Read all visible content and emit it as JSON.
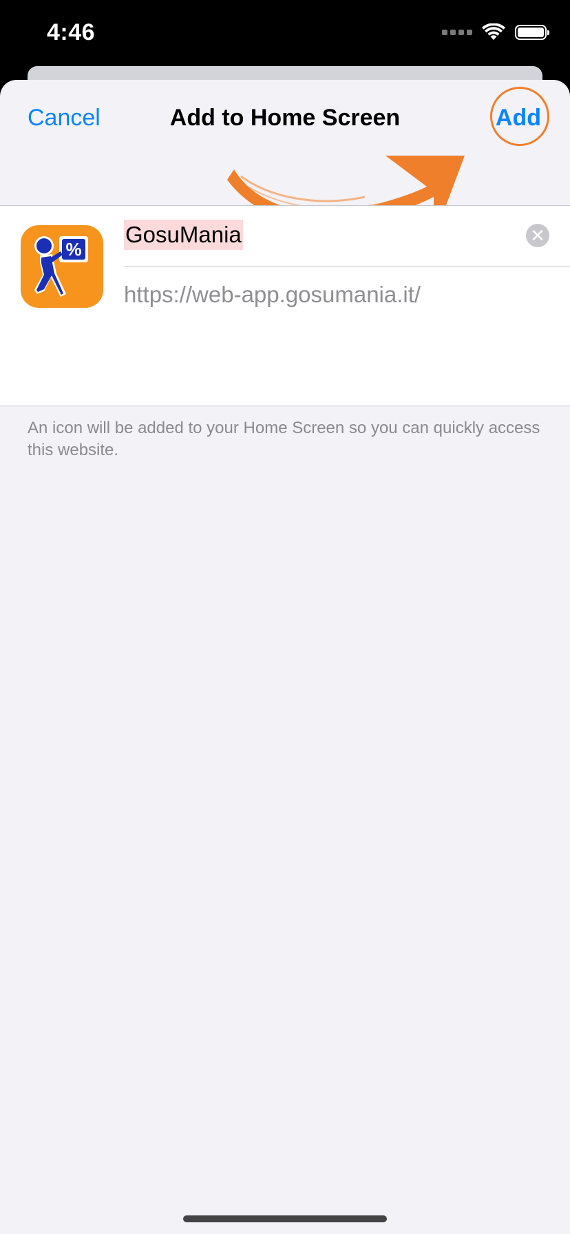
{
  "status_bar": {
    "time": "4:46"
  },
  "nav": {
    "cancel_label": "Cancel",
    "title": "Add to Home Screen",
    "add_label": "Add"
  },
  "form": {
    "name_value": "GosuMania",
    "url_value": "https://web-app.gosumania.it/",
    "clear_icon": "✕"
  },
  "footer": {
    "description": "An icon will be added to your Home Screen so you can quickly access this website."
  },
  "colors": {
    "accent": "#0a84ff",
    "annotation": "#f07f2c",
    "app_icon_bg": "#f7941d",
    "app_icon_figure": "#1a2fb4"
  },
  "icons": {
    "wifi": "wifi-icon",
    "battery": "battery-icon",
    "signal": "signal-icon",
    "app": "gosumania-app-icon",
    "clear": "clear-icon",
    "arrow": "arrow-annotation-icon"
  }
}
